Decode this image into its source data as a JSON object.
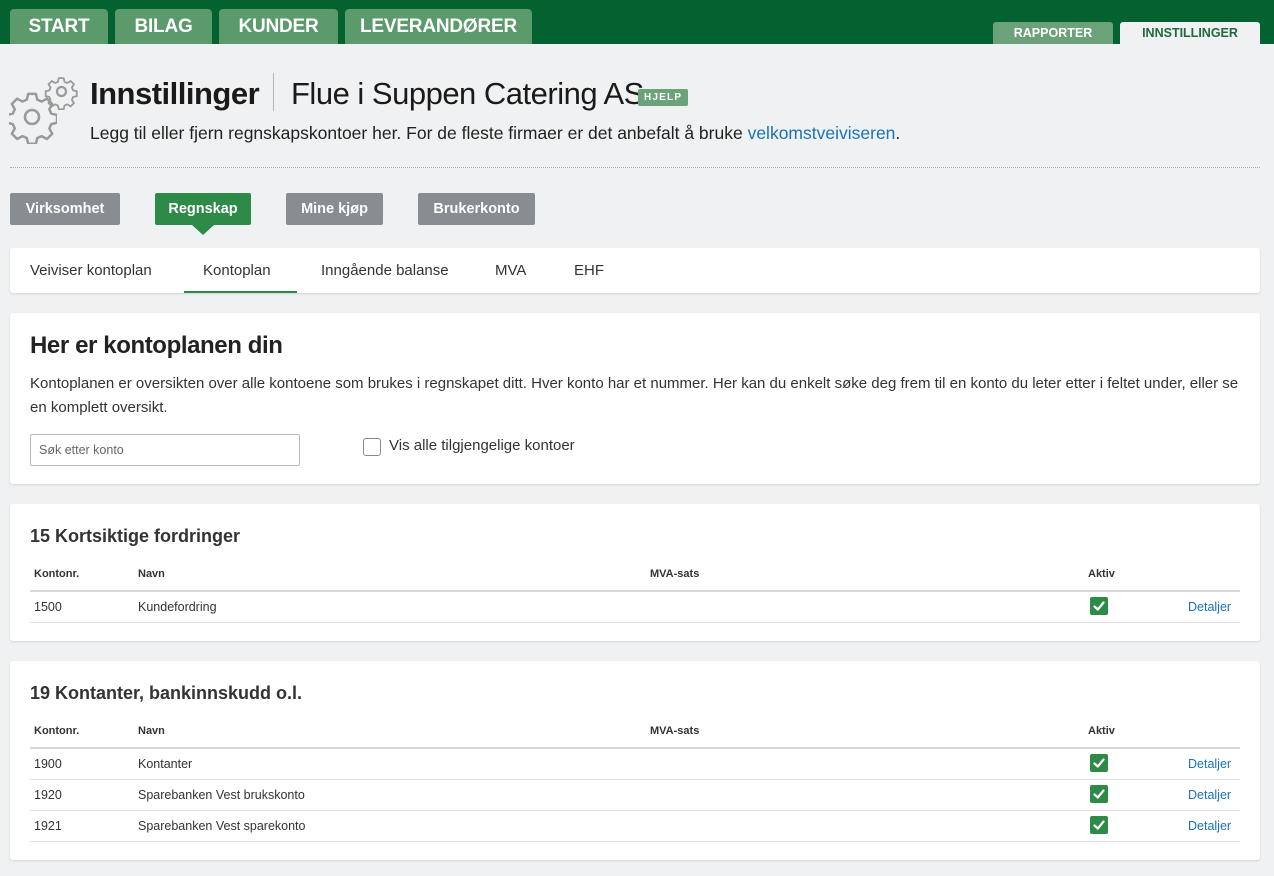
{
  "nav": {
    "main_tabs": [
      "START",
      "BILAG",
      "KUNDER",
      "LEVERANDØRER"
    ],
    "secondary_tabs": [
      "RAPPORTER",
      "INNSTILLINGER"
    ],
    "active_secondary": "INNSTILLINGER"
  },
  "header": {
    "title": "Innstillinger",
    "company": "Flue i Suppen Catering AS",
    "help_badge": "HJELP",
    "subtitle_prefix": "Legg til eller fjern regnskapskontoer her. For de fleste firmaer er det anbefalt å bruke ",
    "subtitle_link": "velkomstveiviseren",
    "subtitle_suffix": "."
  },
  "categories": [
    "Virksomhet",
    "Regnskap",
    "Mine kjøp",
    "Brukerkonto"
  ],
  "active_category": "Regnskap",
  "subtabs": [
    "Veiviser kontoplan",
    "Kontoplan",
    "Inngående balanse",
    "MVA",
    "EHF"
  ],
  "active_subtab": "Kontoplan",
  "intro": {
    "title": "Her er kontoplanen din",
    "description": "Kontoplanen er oversikten over alle kontoene som brukes i regnskapet ditt. Hver konto har et nummer. Her kan du enkelt søke deg frem til en konto du leter etter i feltet under, eller se en komplett oversikt.",
    "search_placeholder": "Søk etter konto",
    "show_all_label": "Vis alle tilgjengelige kontoer"
  },
  "table_headers": {
    "number": "Kontonr.",
    "name": "Navn",
    "vat": "MVA-sats",
    "active": "Aktiv"
  },
  "groups": [
    {
      "title": "15 Kortsiktige fordringer",
      "rows": [
        {
          "number": "1500",
          "name": "Kundefordring",
          "vat": "",
          "active": true,
          "link": "Detaljer"
        }
      ]
    },
    {
      "title": "19 Kontanter, bankinnskudd o.l.",
      "rows": [
        {
          "number": "1900",
          "name": "Kontanter",
          "vat": "",
          "active": true,
          "link": "Detaljer"
        },
        {
          "number": "1920",
          "name": "Sparebanken Vest brukskonto",
          "vat": "",
          "active": true,
          "link": "Detaljer"
        },
        {
          "number": "1921",
          "name": "Sparebanken Vest sparekonto",
          "vat": "",
          "active": true,
          "link": "Detaljer"
        }
      ]
    }
  ],
  "colors": {
    "topbar": "#03622f",
    "tab": "#5b9a6b",
    "accent": "#2d8a47",
    "link": "#1a72b8",
    "category_inactive": "#888d91"
  }
}
